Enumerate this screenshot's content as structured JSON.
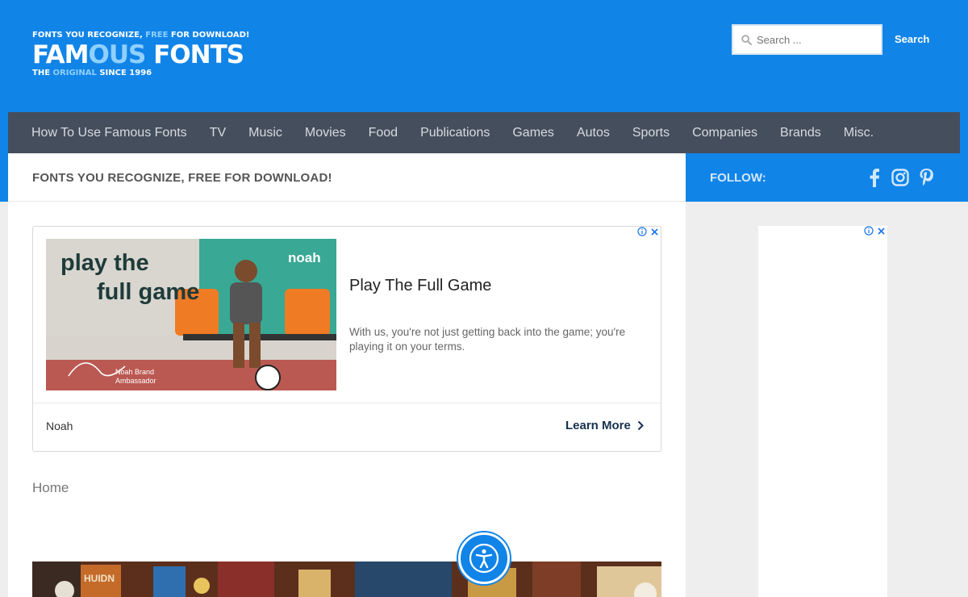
{
  "header": {
    "tagline_pre": "FONTS YOU RECOGNIZE, ",
    "tagline_hl": "FREE",
    "tagline_post": " FOR DOWNLOAD!",
    "logo_part1": "FAM",
    "logo_part2": "OUS",
    "logo_part3": " FONTS",
    "since_pre": "THE ",
    "since_hl": "ORIGINAL",
    "since_post": " SINCE 1996",
    "search_placeholder": "Search ...",
    "search_button": "Search",
    "icons": {
      "search": "search-icon"
    }
  },
  "nav": {
    "items": [
      "How To Use Famous Fonts",
      "TV",
      "Music",
      "Movies",
      "Food",
      "Publications",
      "Games",
      "Autos",
      "Sports",
      "Companies",
      "Brands",
      "Misc."
    ]
  },
  "main": {
    "title": "FONTS YOU RECOGNIZE, FREE FOR DOWNLOAD!",
    "breadcrumb": "Home"
  },
  "ad": {
    "image_headline_line1": "play the",
    "image_headline_line2": "full game",
    "image_brand_logo": "noah",
    "image_caption_line1": "Noah Brand",
    "image_caption_line2": "Ambassador",
    "title": "Play The Full Game",
    "description": "With us, you're not just getting back into the game; you're playing it on your terms.",
    "brand": "Noah",
    "cta": "Learn More"
  },
  "banner": {
    "text": "HUIDN"
  },
  "sidebar": {
    "follow_label": "FOLLOW:",
    "social": [
      "facebook-icon",
      "instagram-icon",
      "pinterest-icon"
    ]
  },
  "colors": {
    "header_blue": "#1184e8",
    "nav_bg": "#454e5c",
    "logo_highlight": "#8fd0ff"
  }
}
